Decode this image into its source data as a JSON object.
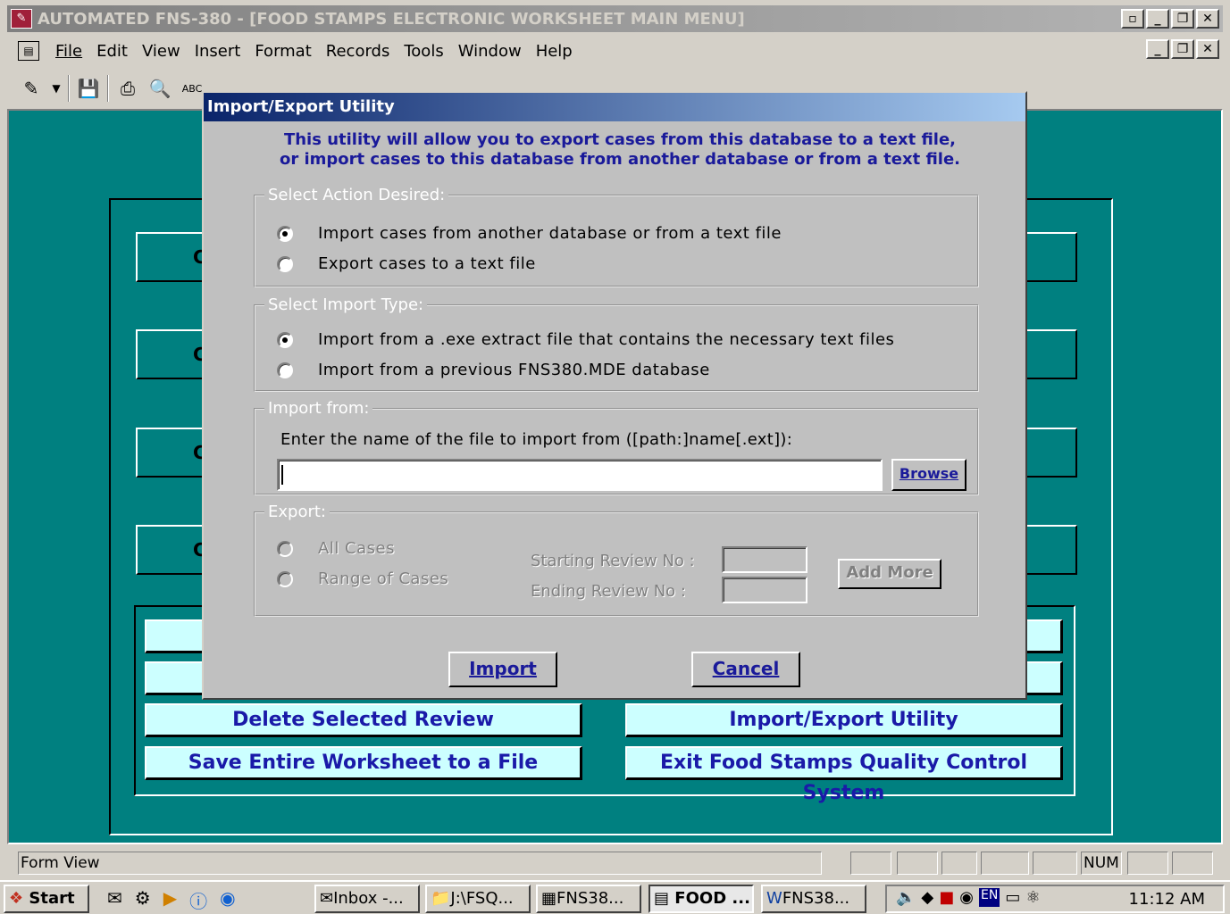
{
  "window": {
    "title": "AUTOMATED FNS-380 - [FOOD STAMPS  ELECTRONIC WORKSHEET MAIN MENU]"
  },
  "menu": [
    "File",
    "Edit",
    "View",
    "Insert",
    "Format",
    "Records",
    "Tools",
    "Window",
    "Help"
  ],
  "main_menu": {
    "buttons": {
      "delete": "Delete Selected Review",
      "import_export": "Import/Export Utility",
      "save": "Save Entire Worksheet to a File",
      "exit": "Exit Food Stamps Quality Control System"
    },
    "obscured_button_letter": "C"
  },
  "dialog": {
    "title": "Import/Export Utility",
    "intro_line1": "This utility will allow you to export cases from this database to a text file,",
    "intro_line2": "or import cases to this database from another database or from a text file.",
    "action_group": {
      "legend": "Select Action Desired:",
      "options": [
        "Import cases from another database or from a text file",
        "Export cases to a text file"
      ],
      "selected": 0
    },
    "import_type_group": {
      "legend": "Select Import Type:",
      "options": [
        "Import from a .exe extract file that contains the necessary text files",
        "Import from a previous FNS380.MDE database"
      ],
      "selected": 0
    },
    "import_from_group": {
      "legend": "Import from:",
      "prompt": "Enter the name of the file to import from  ([path:]name[.ext]):",
      "file_value": "",
      "browse_label": "Browse"
    },
    "export_group": {
      "legend": "Export:",
      "options": [
        "All Cases",
        "Range of Cases"
      ],
      "starting_label": "Starting Review No :",
      "ending_label": "Ending  Review  No :",
      "add_more_label": "Add More"
    },
    "import_button": "Import",
    "cancel_button": "Cancel"
  },
  "statusbar": {
    "mode": "Form View",
    "num": "NUM"
  },
  "taskbar": {
    "start": "Start",
    "tasks": [
      "Inbox -...",
      "J:\\FSQ...",
      "FNS38...",
      "FOOD ...",
      "FNS38..."
    ],
    "tray_lang": "EN",
    "clock": "11:12 AM"
  }
}
